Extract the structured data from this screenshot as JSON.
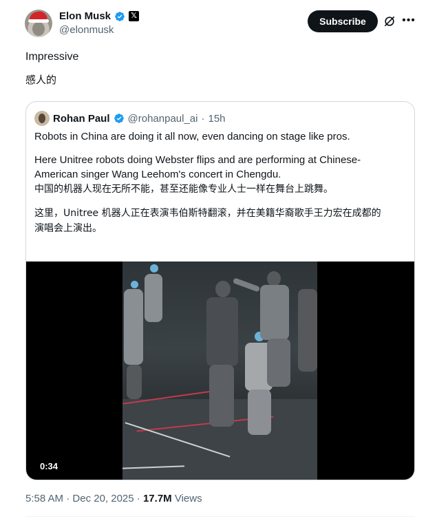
{
  "author": {
    "display_name": "Elon Musk",
    "handle": "@elonmusk",
    "x_badge": "𝕏"
  },
  "actions": {
    "subscribe_label": "Subscribe"
  },
  "tweet": {
    "line1": "Impressive",
    "line2": "感人的"
  },
  "quoted": {
    "display_name": "Rohan Paul",
    "handle": "@rohanpaul_ai",
    "separator": "·",
    "age": "15h",
    "paragraph1": "Robots in China are doing it all now, even dancing on stage like pros.",
    "paragraph2_line1": "Here Unitree robots doing Webster flips and are performing at Chinese-",
    "paragraph2_line2": "American singer Wang Leehom's concert in Chengdu.",
    "paragraph3": "中国的机器人现在无所不能，甚至还能像专业人士一样在舞台上跳舞。",
    "paragraph4_line1": "这里，Unitree 机器人正在表演韦伯斯特翻滚，并在美籍华裔歌手王力宏在成都的",
    "paragraph4_line2": "演唱会上演出。",
    "video_duration": "0:34"
  },
  "meta": {
    "time": "5:58 AM",
    "date_sep": " · ",
    "date": "Dec 20, 2025",
    "views_sep": " · ",
    "views_count": "17.7M",
    "views_label": " Views"
  },
  "colors": {
    "verified": "#1d9bf0",
    "text_primary": "#0f1419",
    "text_secondary": "#536471",
    "border": "#cfd9de"
  },
  "icons": [
    "verified-badge-icon",
    "x-logo-icon",
    "grok-icon",
    "more-icon"
  ]
}
